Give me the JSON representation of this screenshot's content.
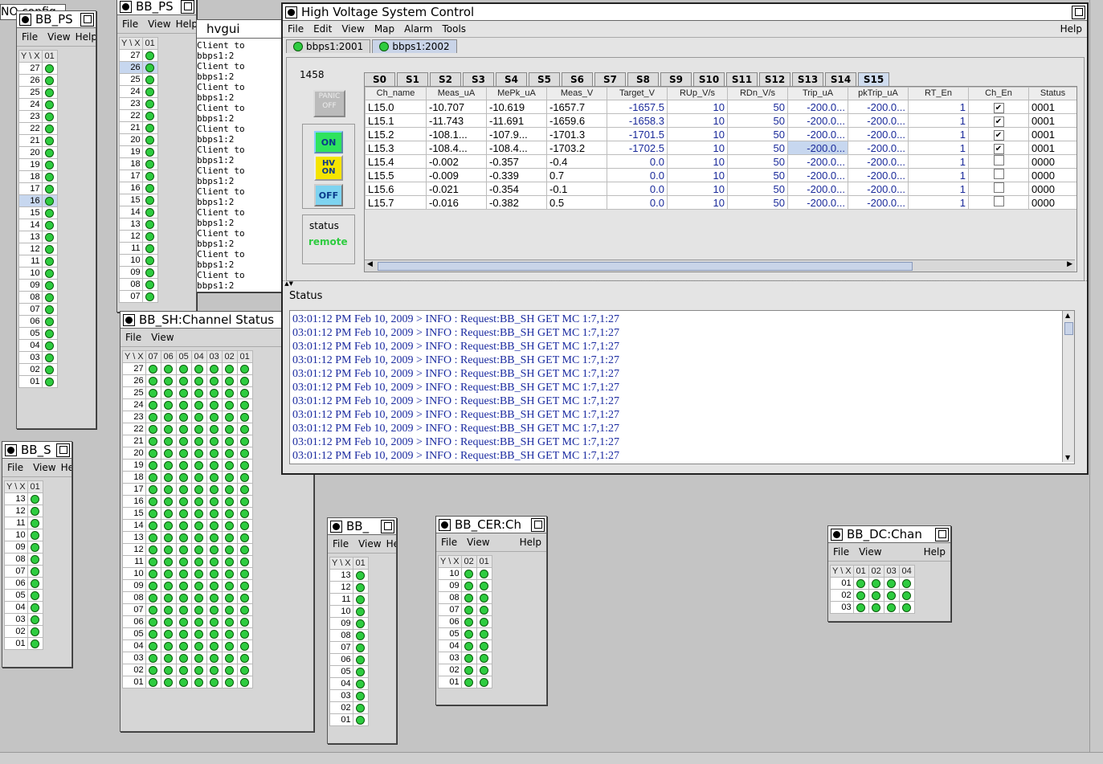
{
  "stray_title": "NO config",
  "main": {
    "title": "High Voltage System Control",
    "menu": [
      "File",
      "Edit",
      "View",
      "Map",
      "Alarm",
      "Tools"
    ],
    "help": "Help",
    "server_tabs": [
      "bbps1:2001",
      "bbps1:2002"
    ],
    "panel_number": "1458",
    "panic_label": "PANIC OFF",
    "on_label": "ON",
    "hvon_label": "HV ON",
    "off_label": "OFF",
    "status_label": "status",
    "status_value": "remote",
    "slot_tabs": [
      "S0",
      "S1",
      "S2",
      "S3",
      "S4",
      "S5",
      "S6",
      "S7",
      "S8",
      "S9",
      "S10",
      "S11",
      "S12",
      "S13",
      "S14",
      "S15"
    ],
    "columns": [
      "Ch_name",
      "Meas_uA",
      "MePk_uA",
      "Meas_V",
      "Target_V",
      "RUp_V/s",
      "RDn_V/s",
      "Trip_uA",
      "pkTrip_uA",
      "RT_En",
      "Ch_En",
      "Status"
    ],
    "rows": [
      [
        "L15.0",
        "-10.707",
        "-10.619",
        "-1657.7",
        "-1657.5",
        "10",
        "50",
        "-200.0...",
        "-200.0...",
        "1",
        "✔",
        "0001"
      ],
      [
        "L15.1",
        "-11.743",
        "-11.691",
        "-1659.6",
        "-1658.3",
        "10",
        "50",
        "-200.0...",
        "-200.0...",
        "1",
        "✔",
        "0001"
      ],
      [
        "L15.2",
        "-108.1...",
        "-107.9...",
        "-1701.3",
        "-1701.5",
        "10",
        "50",
        "-200.0...",
        "-200.0...",
        "1",
        "✔",
        "0001"
      ],
      [
        "L15.3",
        "-108.4...",
        "-108.4...",
        "-1703.2",
        "-1702.5",
        "10",
        "50",
        "-200.0...",
        "-200.0...",
        "1",
        "✔",
        "0001"
      ],
      [
        "L15.4",
        "-0.002",
        "-0.357",
        "-0.4",
        "0.0",
        "10",
        "50",
        "-200.0...",
        "-200.0...",
        "1",
        "",
        "0000"
      ],
      [
        "L15.5",
        "-0.009",
        "-0.339",
        "0.7",
        "0.0",
        "10",
        "50",
        "-200.0...",
        "-200.0...",
        "1",
        "",
        "0000"
      ],
      [
        "L15.6",
        "-0.021",
        "-0.354",
        "-0.1",
        "0.0",
        "10",
        "50",
        "-200.0...",
        "-200.0...",
        "1",
        "",
        "0000"
      ],
      [
        "L15.7",
        "-0.016",
        "-0.382",
        "0.5",
        "0.0",
        "10",
        "50",
        "-200.0...",
        "-200.0...",
        "1",
        "",
        "0000"
      ]
    ],
    "status_title": "Status",
    "log": [
      "03:01:12 PM Feb 10, 2009 > INFO : Request:BB_SH GET MC 1:7,1:27",
      "03:01:12 PM Feb 10, 2009 > INFO : Request:BB_SH GET MC 1:7,1:27",
      "03:01:12 PM Feb 10, 2009 > INFO : Request:BB_SH GET MC 1:7,1:27",
      "03:01:12 PM Feb 10, 2009 > INFO : Request:BB_SH GET MC 1:7,1:27",
      "03:01:12 PM Feb 10, 2009 > INFO : Request:BB_SH GET MC 1:7,1:27",
      "03:01:12 PM Feb 10, 2009 > INFO : Request:BB_SH GET MC 1:7,1:27",
      "03:01:12 PM Feb 10, 2009 > INFO : Request:BB_SH GET MC 1:7,1:27",
      "03:01:12 PM Feb 10, 2009 > INFO : Request:BB_SH GET MC 1:7,1:27",
      "03:01:12 PM Feb 10, 2009 > INFO : Request:BB_SH GET MC 1:7,1:27",
      "03:01:12 PM Feb 10, 2009 > INFO : Request:BB_SH GET MC 1:7,1:27",
      "03:01:12 PM Feb 10, 2009 > INFO : Request:BB_SH GET MC 1:7,1:27"
    ]
  },
  "hvgui": {
    "title": "hvgui",
    "lines": [
      "Client to bbps1:2",
      "Client to bbps1:2",
      "Client to bbps1:2",
      "Client to bbps1:2",
      "Client to bbps1:2",
      "Client to bbps1:2",
      "Client to bbps1:2",
      "Client to bbps1:2",
      "Client to bbps1:2",
      "Client to bbps1:2",
      "Client to bbps1:2",
      "Client to bbps1:2",
      "Client to bbps1:2",
      "Client to bbps1:2",
      "Client to bbps1:2",
      "Client to bbps1:2",
      "Client to bbps1:2",
      "Client to bbps1:2",
      "Client to bbps1:2",
      "Client to bbps1:2",
      "Client to bbps1:2",
      "Client to bbps1:2",
      "Client to bbps1:2"
    ]
  },
  "grids": [
    {
      "id": "ps1",
      "title": "BB_PS",
      "menu": [
        "File",
        "View",
        "Help"
      ],
      "corner": "Y \\ X",
      "cols": [
        "01"
      ],
      "rows": [
        "27",
        "26",
        "25",
        "24",
        "23",
        "22",
        "21",
        "20",
        "19",
        "18",
        "17",
        "16",
        "15",
        "14",
        "13",
        "12",
        "11",
        "10",
        "09",
        "08",
        "07",
        "06",
        "05",
        "04",
        "03",
        "02",
        "01"
      ],
      "selected": "16"
    },
    {
      "id": "ps2",
      "title": "BB_PS",
      "menu": [
        "File",
        "View",
        "Help"
      ],
      "corner": "Y \\ X",
      "cols": [
        "01"
      ],
      "rows": [
        "27",
        "26",
        "25",
        "24",
        "23",
        "22",
        "21",
        "20",
        "19",
        "18",
        "17",
        "16",
        "15",
        "14",
        "13",
        "12",
        "11",
        "10",
        "09",
        "08",
        "07"
      ],
      "selected": "26"
    },
    {
      "id": "sh",
      "title": "BB_SH:Channel Status",
      "menu": [
        "File",
        "View"
      ],
      "corner": "Y \\ X",
      "cols": [
        "07",
        "06",
        "05",
        "04",
        "03",
        "02",
        "01"
      ],
      "rows": [
        "27",
        "26",
        "25",
        "24",
        "23",
        "22",
        "21",
        "20",
        "19",
        "18",
        "17",
        "16",
        "15",
        "14",
        "13",
        "12",
        "11",
        "10",
        "09",
        "08",
        "07",
        "06",
        "05",
        "04",
        "03",
        "02",
        "01"
      ],
      "selected": ""
    },
    {
      "id": "sm",
      "title": "BB_S",
      "menu": [
        "File",
        "View",
        "Help"
      ],
      "corner": "Y \\ X",
      "cols": [
        "01"
      ],
      "rows": [
        "13",
        "12",
        "11",
        "10",
        "09",
        "08",
        "07",
        "06",
        "05",
        "04",
        "03",
        "02",
        "01"
      ],
      "selected": ""
    },
    {
      "id": "bb",
      "title": "BB_",
      "menu": [
        "File",
        "View",
        "Help"
      ],
      "corner": "Y \\ X",
      "cols": [
        "01"
      ],
      "rows": [
        "13",
        "12",
        "11",
        "10",
        "09",
        "08",
        "07",
        "06",
        "05",
        "04",
        "03",
        "02",
        "01"
      ],
      "selected": ""
    },
    {
      "id": "cer",
      "title": "BB_CER:Ch",
      "menu": [
        "File",
        "View",
        "Help"
      ],
      "corner": "Y \\ X",
      "cols": [
        "02",
        "01"
      ],
      "rows": [
        "10",
        "09",
        "08",
        "07",
        "06",
        "05",
        "04",
        "03",
        "02",
        "01"
      ],
      "selected": ""
    },
    {
      "id": "dc",
      "title": "BB_DC:Chan",
      "menu": [
        "File",
        "View",
        "Help"
      ],
      "corner": "Y \\ X",
      "cols": [
        "01",
        "02",
        "03",
        "04"
      ],
      "rows": [
        "01",
        "02",
        "03"
      ],
      "selected": ""
    }
  ]
}
